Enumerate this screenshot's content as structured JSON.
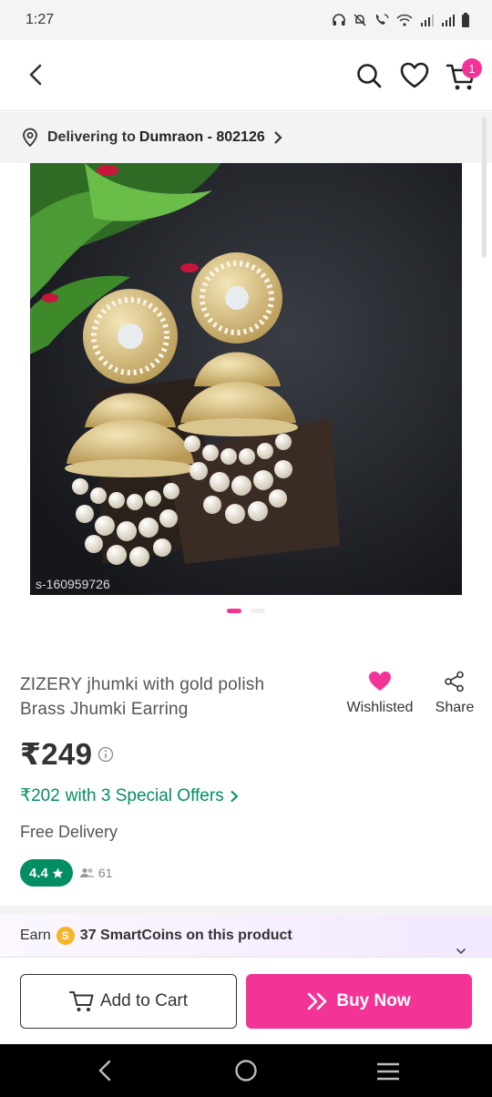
{
  "status_bar": {
    "time": "1:27",
    "icons": [
      "headphones-icon",
      "mute-icon",
      "wifi-calling-icon",
      "wifi-icon",
      "signal-icon",
      "signal-icon",
      "battery-icon"
    ]
  },
  "header": {
    "icons": [
      "back-arrow-icon",
      "search-icon",
      "heart-icon",
      "cart-icon"
    ],
    "cart_count": "1"
  },
  "delivery": {
    "prefix": "Delivering to",
    "location": "Dumraon - 802126"
  },
  "product": {
    "image_sku": "s-160959726",
    "image_count": 2,
    "active_image_index": 0,
    "title": "ZIZERY jhumki with gold polish Brass Jhumki Earring",
    "wishlist_label": "Wishlisted",
    "share_label": "Share",
    "price": "₹249",
    "offer_price": "₹202",
    "offer_text": "with 3 Special Offers",
    "delivery_text": "Free Delivery",
    "rating": "4.4",
    "review_count": "61"
  },
  "smartcoins": {
    "prefix": "Earn",
    "coin_symbol": "S",
    "text": "37 SmartCoins on this product"
  },
  "actions": {
    "add_to_cart": "Add to Cart",
    "buy_now": "Buy Now"
  },
  "colors": {
    "accent": "#f43397",
    "offer_green": "#038d63",
    "rating_green": "#038d63",
    "coin": "#f7b52a"
  }
}
